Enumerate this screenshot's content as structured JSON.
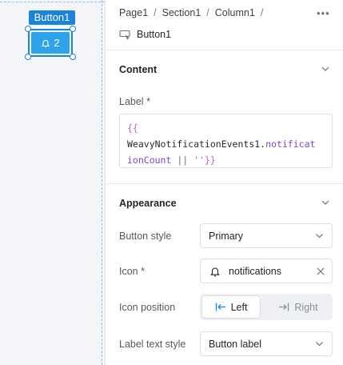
{
  "canvas": {
    "component_tag": "Button1",
    "button_badge_count": "2",
    "accent": "#1a84da",
    "button_color": "#2ea3ec"
  },
  "panel": {
    "breadcrumb": [
      "Page1",
      "Section1",
      "Column1"
    ],
    "more_icon": "ellipsis-icon",
    "component_name": "Button1",
    "component_icon": "button-component-icon"
  },
  "content": {
    "title": "Content",
    "label_field": "Label",
    "required_mark": "*",
    "code": {
      "open": "{{",
      "ident": "WeavyNotificationEvents1",
      "dot": ".",
      "prop_part1": "notificat",
      "prop_part2": "ionCount",
      "op": " || ",
      "str": "''",
      "close": "}}"
    }
  },
  "appearance": {
    "title": "Appearance",
    "button_style_label": "Button style",
    "button_style_value": "Primary",
    "icon_label": "Icon",
    "icon_required": "*",
    "icon_value": "notifications",
    "icon_position_label": "Icon position",
    "icon_position_options": [
      "Left",
      "Right"
    ],
    "icon_position_selected": "Left",
    "label_text_style_label": "Label text style",
    "label_text_style_value": "Button label"
  }
}
